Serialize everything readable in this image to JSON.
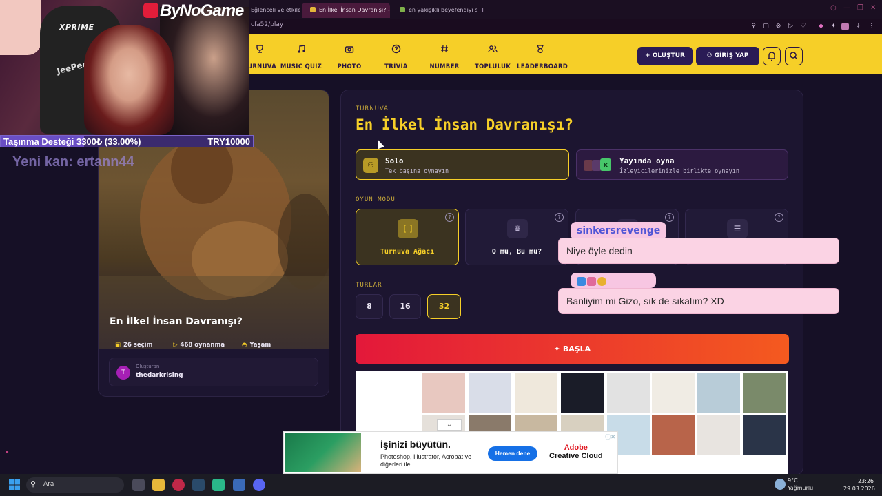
{
  "browser": {
    "tabs": [
      {
        "title": "Eğlenceli ve etkileşimli",
        "active": false
      },
      {
        "title": "En İlkel İnsan Davranışı? -",
        "active": true
      },
      {
        "title": "en yakışıklı beyefendiyi seç",
        "active": false
      }
    ],
    "url_visible": "cfa52/play"
  },
  "site": {
    "nav": [
      {
        "label": "TURNUVA",
        "icon": "trophy-icon"
      },
      {
        "label": "MUSIC QUIZ",
        "icon": "music-note-icon"
      },
      {
        "label": "PHOTO QUIZ",
        "icon": "camera-icon"
      },
      {
        "label": "TRİVİA",
        "icon": "question-icon"
      },
      {
        "label": "NUMBER QUIZ",
        "icon": "hash-icon"
      },
      {
        "label": "TOPLULUK",
        "icon": "users-icon"
      },
      {
        "label": "LEADERBOARD",
        "icon": "medal-icon"
      }
    ],
    "create_label": "+ OLUŞTUR",
    "login_label": "GİRİŞ YAP",
    "accent": "#f6cf28"
  },
  "card": {
    "title": "En İlkel İnsan Davranışı?",
    "choices": "26 seçim",
    "plays": "468 oynanma",
    "category": "Yaşam",
    "creator_label": "Oluşturan",
    "creator_initial": "T",
    "creator_name": "thedarkrising"
  },
  "main": {
    "section": "TURNUVA",
    "title": "En İlkel İnsan Davranışı?",
    "modes": [
      {
        "title": "Solo",
        "subtitle": "Tek başına oynayın",
        "selected": true
      },
      {
        "title": "Yayında oyna",
        "subtitle": "İzleyicilerinizle birlikte oynayın",
        "selected": false
      }
    ],
    "game_mode_label": "OYUN MODU",
    "game_modes": [
      {
        "label": "Turnuva Ağacı",
        "selected": true
      },
      {
        "label": "O mu, Bu mu?",
        "selected": false
      },
      {
        "label": "",
        "selected": false
      },
      {
        "label": "",
        "selected": false
      }
    ],
    "rounds_label": "TURLAR",
    "rounds": [
      {
        "value": "8",
        "selected": false
      },
      {
        "value": "16",
        "selected": false
      },
      {
        "value": "32",
        "selected": true
      }
    ],
    "start_label": "BAŞLA"
  },
  "ad": {
    "headline": "İşinizi büyütün.",
    "body": "Photoshop, Illustrator, Acrobat ve diğerleri ile.",
    "cta": "Hemen dene",
    "brand_line1": "Adobe",
    "brand_line2": "Creative Cloud"
  },
  "stream": {
    "logo": "ByNoGame",
    "chair_brand": "XPRIME",
    "chair_name": "JeePeeT",
    "donation_label": "Taşınma Desteği 3300₺ (33.00%)",
    "donation_goal": "TRY10000",
    "donation_progress": 0.33,
    "new_sub": "Yeni kan: ertann44"
  },
  "chat": [
    {
      "user": "sinkersrevenge",
      "message": "Niye öyle dedin"
    },
    {
      "user": "",
      "message": "Banliyim mi Gizo, sık de sıkalım? XD"
    }
  ],
  "taskbar": {
    "search_label": "Ara",
    "temperature": "9°C",
    "weather": "Yağmurlu",
    "time": "23:26",
    "date": "29.03.2026"
  }
}
